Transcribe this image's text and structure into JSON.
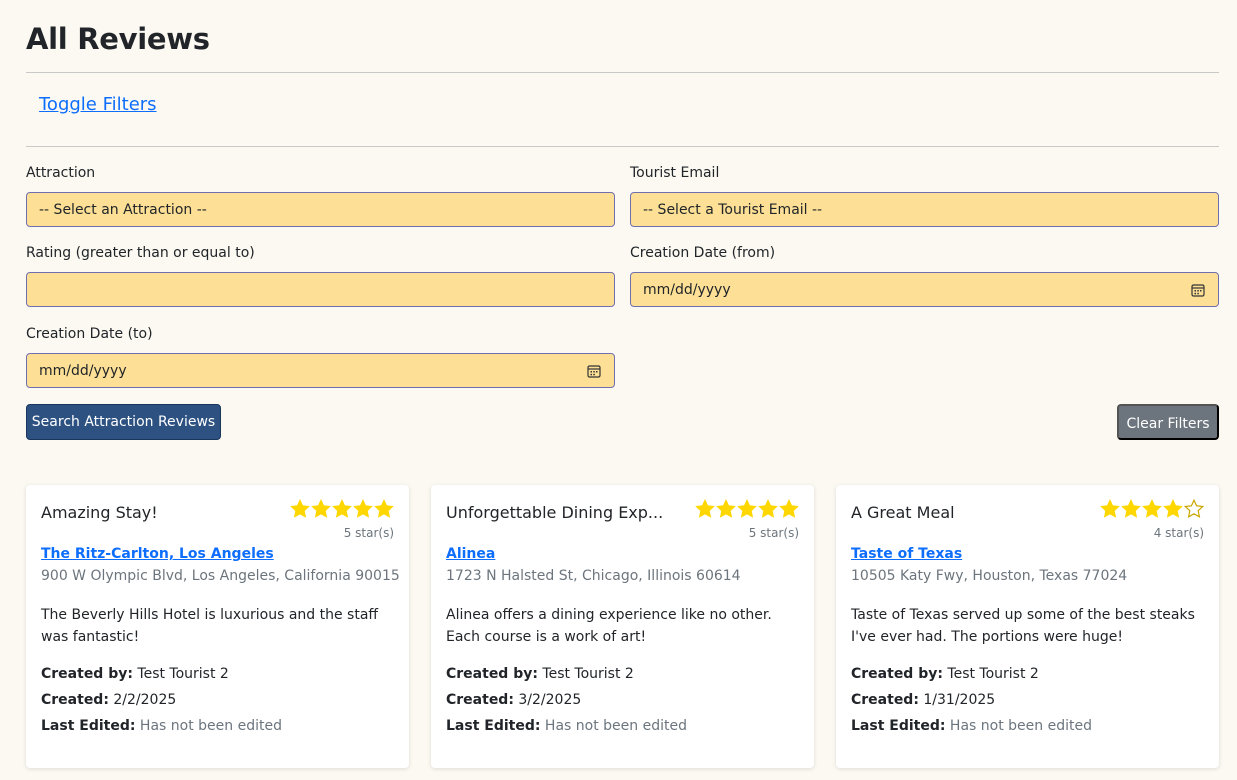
{
  "page": {
    "title": "All Reviews"
  },
  "filters": {
    "toggle_label": "Toggle Filters",
    "attraction": {
      "label": "Attraction",
      "value": "-- Select an Attraction --"
    },
    "tourist_email": {
      "label": "Tourist Email",
      "value": "-- Select a Tourist Email --"
    },
    "rating": {
      "label": "Rating (greater than or equal to)",
      "value": ""
    },
    "date_from": {
      "label": "Creation Date (from)",
      "placeholder": "mm/dd/yyyy"
    },
    "date_to": {
      "label": "Creation Date (to)",
      "placeholder": "mm/dd/yyyy"
    },
    "search_label": "Search Attraction Reviews",
    "clear_label": "Clear Filters"
  },
  "labels": {
    "created_by": "Created by:",
    "created": "Created:",
    "last_edited": "Last Edited:"
  },
  "colors": {
    "star_filled": "#FFD700",
    "star_empty": "#c9a600",
    "link": "#0d6efd",
    "input_bg": "#fde095",
    "primary_button": "#2d5282",
    "secondary_button": "#6c757d"
  },
  "reviews": [
    {
      "title": "Amazing Stay!",
      "rating": 5,
      "rating_text": "5 star(s)",
      "attraction": "The Ritz-Carlton, Los Angeles",
      "address": "900 W Olympic Blvd, Los Angeles, California 90015",
      "content": "The Beverly Hills Hotel is luxurious and the staff was fantastic!",
      "created_by": "Test Tourist 2",
      "created": "2/2/2025",
      "last_edited": "Has not been edited"
    },
    {
      "title": "Unforgettable Dining Exp...",
      "rating": 5,
      "rating_text": "5 star(s)",
      "attraction": "Alinea",
      "address": "1723 N Halsted St, Chicago, Illinois 60614",
      "content": "Alinea offers a dining experience like no other. Each course is a work of art!",
      "created_by": "Test Tourist 2",
      "created": "3/2/2025",
      "last_edited": "Has not been edited"
    },
    {
      "title": "A Great Meal",
      "rating": 4,
      "rating_text": "4 star(s)",
      "attraction": "Taste of Texas",
      "address": "10505 Katy Fwy, Houston, Texas 77024",
      "content": "Taste of Texas served up some of the best steaks I've ever had. The portions were huge!",
      "created_by": "Test Tourist 2",
      "created": "1/31/2025",
      "last_edited": "Has not been edited"
    }
  ]
}
